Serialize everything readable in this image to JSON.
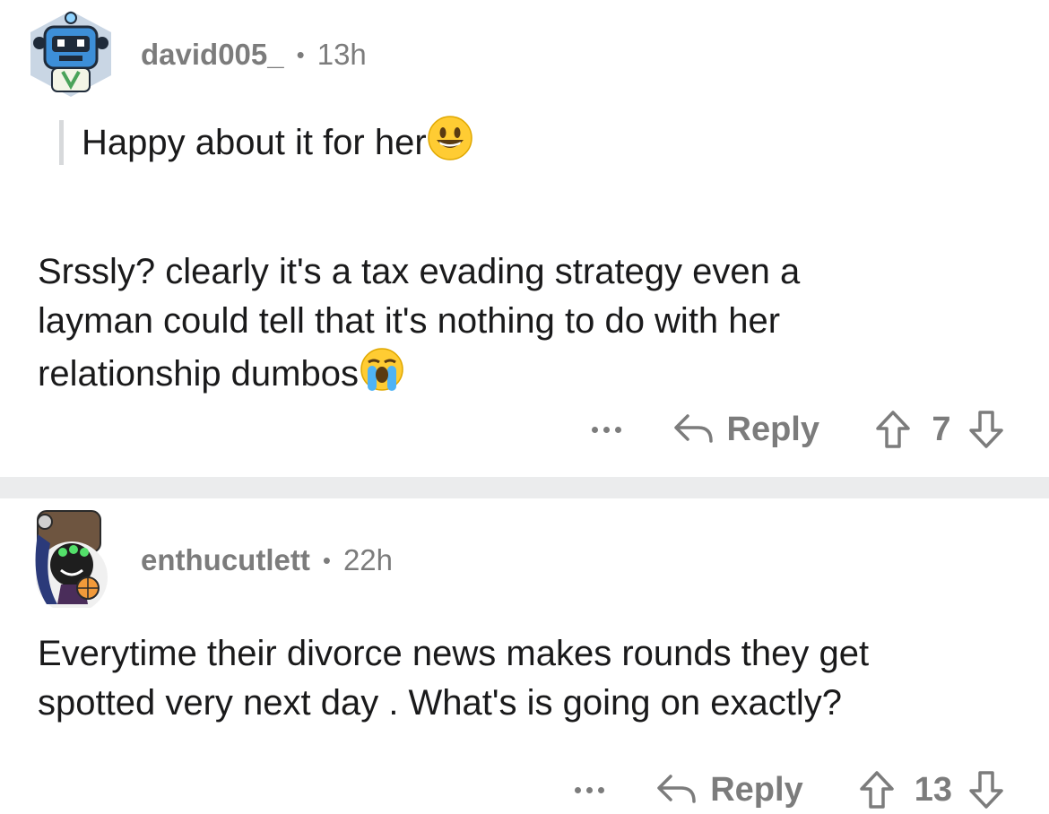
{
  "comments": [
    {
      "username": "david005_",
      "separator": "•",
      "age": "13h",
      "quote": "Happy about it for her",
      "quote_emoji": "grinning-face-emoji",
      "body_lines": [
        "Srssly? clearly it's a tax evading strategy even a",
        "layman could tell that it's nothing to do with her",
        "relationship dumbos"
      ],
      "body_emoji": "loudly-crying-face-emoji",
      "reply_label": "Reply",
      "score": "7"
    },
    {
      "username": "enthucutlett",
      "separator": "•",
      "age": "22h",
      "body_lines": [
        "Everytime their divorce news makes rounds they get",
        "spotted very next day . What's is going on exactly?"
      ],
      "reply_label": "Reply",
      "score": "13"
    }
  ],
  "icons": {
    "more": "more-options-icon",
    "reply": "reply-arrow-icon",
    "upvote": "upvote-arrow-icon",
    "downvote": "downvote-arrow-icon"
  },
  "colors": {
    "meta_gray": "#7c7c7c",
    "separator": "#ebeced",
    "quote_bar": "#d7d9db"
  }
}
